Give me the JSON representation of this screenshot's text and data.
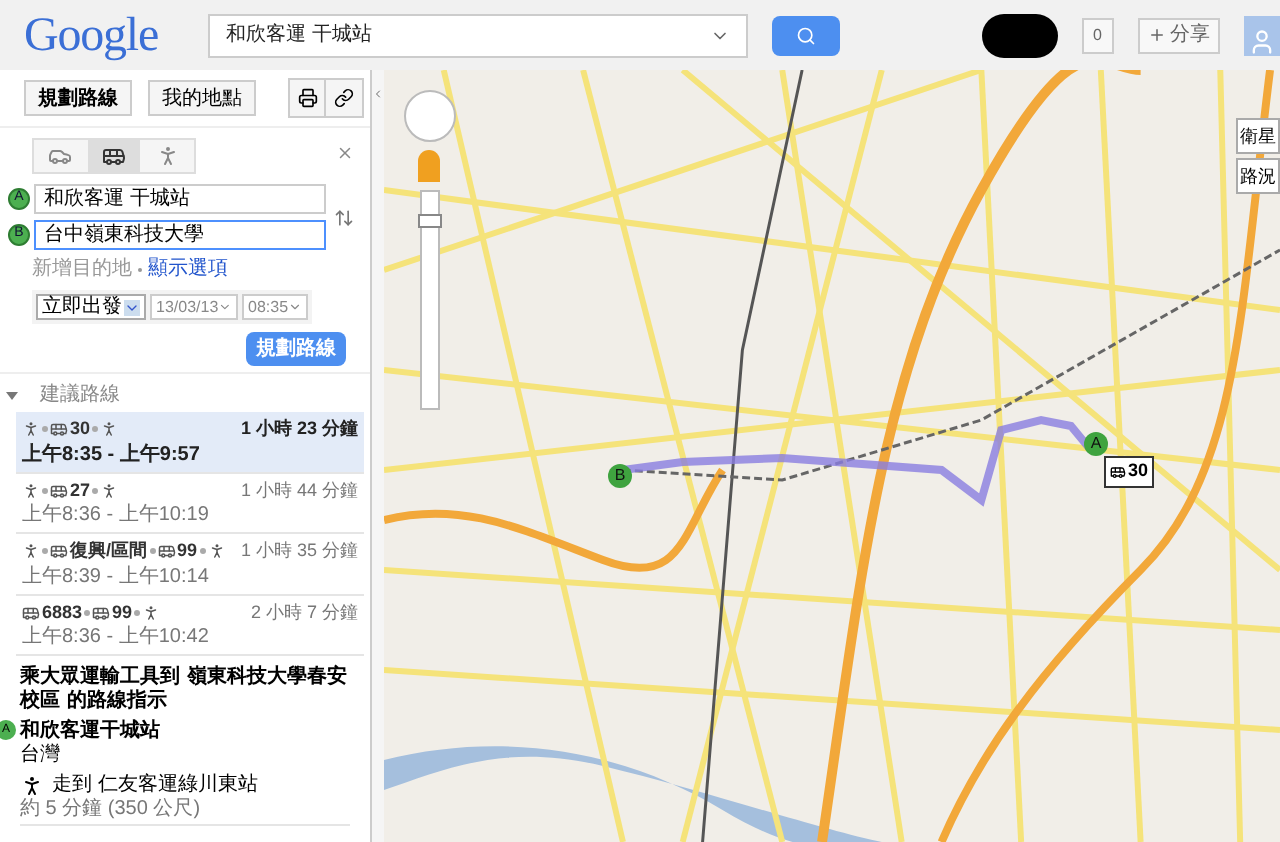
{
  "header": {
    "logo": "Google",
    "search_value": "和欣客運 干城站",
    "count": "0",
    "share": "分享"
  },
  "toolbar": {
    "buttons": [
      "規劃路線",
      "我的地點"
    ]
  },
  "directions": {
    "modes": [
      {
        "kind": "car",
        "selected": false
      },
      {
        "kind": "bus",
        "selected": true
      },
      {
        "kind": "walk",
        "selected": false
      }
    ],
    "origin": {
      "marker": "A",
      "value": "和欣客運 干城站"
    },
    "destination": {
      "marker": "B",
      "value": "台中嶺東科技大學",
      "focused": true
    },
    "add_destination": "新增目的地",
    "show_options": "顯示選項",
    "depart": "立即出發",
    "date": "13/03/13",
    "time": "08:35",
    "submit": "規劃路線"
  },
  "suggested": {
    "title": "建議路線",
    "expanded": true,
    "routes": [
      {
        "selected": true,
        "segments": [
          {
            "kind": "walk"
          },
          {
            "kind": "bus",
            "label": "30"
          },
          {
            "kind": "walk"
          }
        ],
        "duration": "1 小時 23 分鐘",
        "times": "上午8:35 - 上午9:57"
      },
      {
        "selected": false,
        "segments": [
          {
            "kind": "walk"
          },
          {
            "kind": "bus",
            "label": "27"
          },
          {
            "kind": "walk"
          }
        ],
        "duration": "1 小時 44 分鐘",
        "times": "上午8:36 - 上午10:19"
      },
      {
        "selected": false,
        "segments": [
          {
            "kind": "walk"
          },
          {
            "kind": "bus",
            "label": "復興/區間"
          },
          {
            "kind": "bus",
            "label": "99"
          },
          {
            "kind": "walk"
          }
        ],
        "duration": "1 小時 35 分鐘",
        "times": "上午8:39 - 上午10:14"
      },
      {
        "selected": false,
        "segments": [
          {
            "kind": "bus",
            "label": "6883"
          },
          {
            "kind": "bus",
            "label": "99"
          },
          {
            "kind": "walk"
          }
        ],
        "duration": "2 小時 7 分鐘",
        "times": "上午8:36 - 上午10:42"
      }
    ]
  },
  "instructions": {
    "heading": "乘大眾運輸工具到 嶺東科技大學春安校區 的路線指示",
    "start": {
      "marker": "A",
      "name": "和欣客運干城站",
      "region": "台灣"
    },
    "steps": [
      {
        "kind": "walk",
        "text": "走到 仁友客運綠川東站",
        "detail": "約 5 分鐘 (350 公尺)"
      }
    ]
  },
  "map": {
    "controls": {
      "satellite": "衛星",
      "traffic": "路況"
    },
    "markers": [
      {
        "label": "A",
        "color": "#3fa33f"
      },
      {
        "label": "B",
        "color": "#3fa33f"
      }
    ],
    "bus_tag": "30",
    "zoom": {
      "level": 0.9
    }
  }
}
